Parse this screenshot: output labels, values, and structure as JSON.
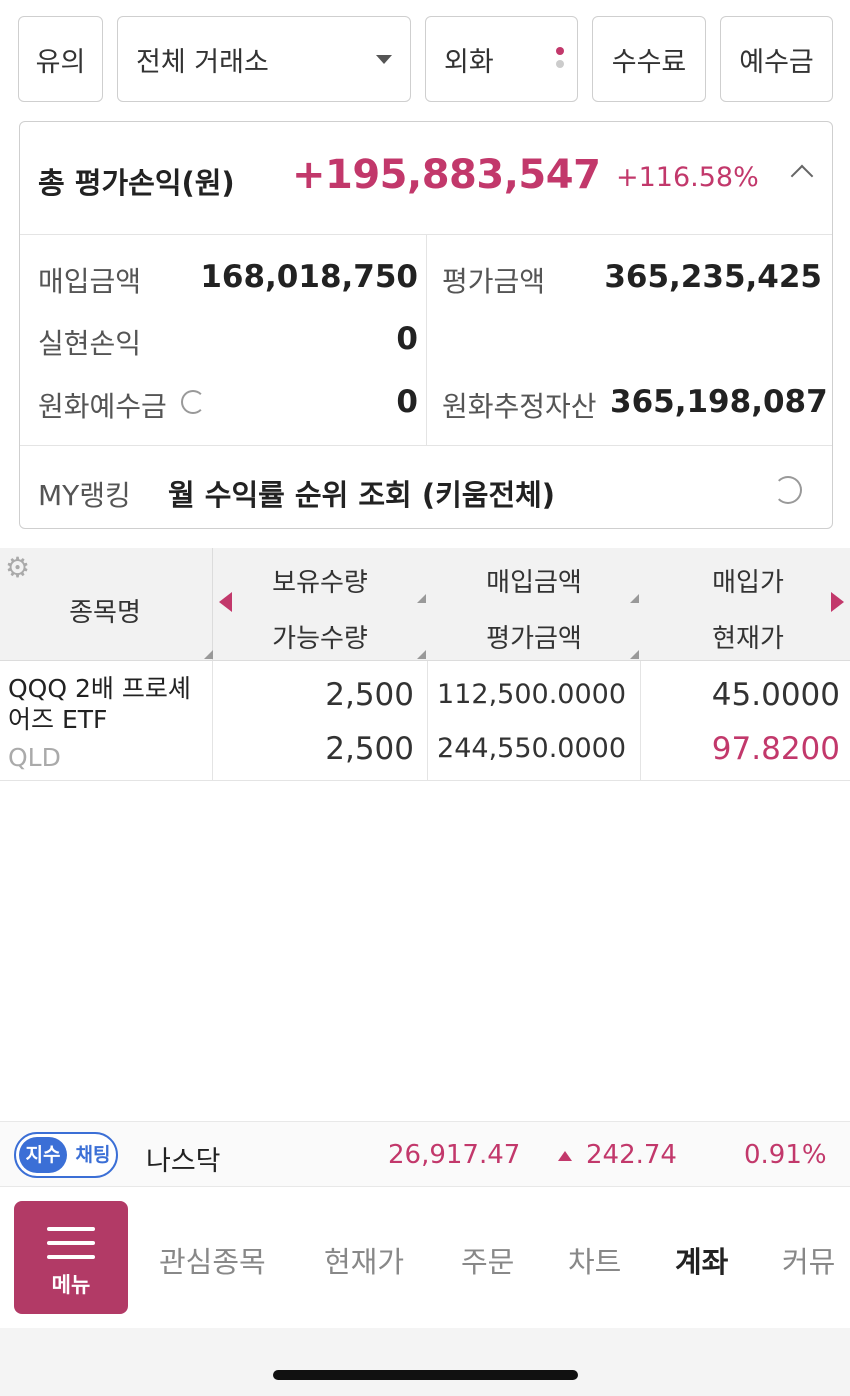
{
  "topbar": {
    "notice": "유의",
    "exchange": "전체 거래소",
    "currency": "외화",
    "fee": "수수료",
    "deposit": "예수금"
  },
  "summary": {
    "total_label": "총 평가손익(원)",
    "total_value": "+195,883,547",
    "total_rate": "+116.58%",
    "purchase_label": "매입금액",
    "purchase_value": "168,018,750",
    "eval_label": "평가금액",
    "eval_value": "365,235,425",
    "realized_label": "실현손익",
    "realized_value": "0",
    "krw_deposit_label": "원화예수금",
    "krw_deposit_value": "0",
    "krw_est_label": "원화추정자산",
    "krw_est_value": "365,198,087",
    "ranking_label": "MY랭킹",
    "ranking_text": "월 수익률 순위 조회 (키움전체)"
  },
  "table": {
    "headers": {
      "name": "종목명",
      "hold_qty": "보유수량",
      "avail_qty": "가능수량",
      "buy_amt": "매입금액",
      "eval_amt": "평가금액",
      "buy_price": "매입가",
      "cur_price": "현재가"
    },
    "rows": [
      {
        "name": "QQQ 2배 프로셰어즈 ETF",
        "code": "QLD",
        "hold_qty": "2,500",
        "avail_qty": "2,500",
        "buy_amt": "112,500.0000",
        "eval_amt": "244,550.0000",
        "buy_price": "45.0000",
        "cur_price": "97.8200"
      }
    ]
  },
  "ticker": {
    "pill_a": "지수",
    "pill_b": "채팅",
    "name": "나스닥",
    "value": "26,917.47",
    "change": "242.74",
    "pct": "0.91%"
  },
  "nav": {
    "menu": "메뉴",
    "items": [
      "관심종목",
      "현재가",
      "주문",
      "차트",
      "계좌",
      "커뮤"
    ],
    "active": "계좌"
  },
  "colors": {
    "accent": "#c2386b",
    "menu_bg": "#b23a66",
    "pill_blue": "#3b6fd6"
  }
}
